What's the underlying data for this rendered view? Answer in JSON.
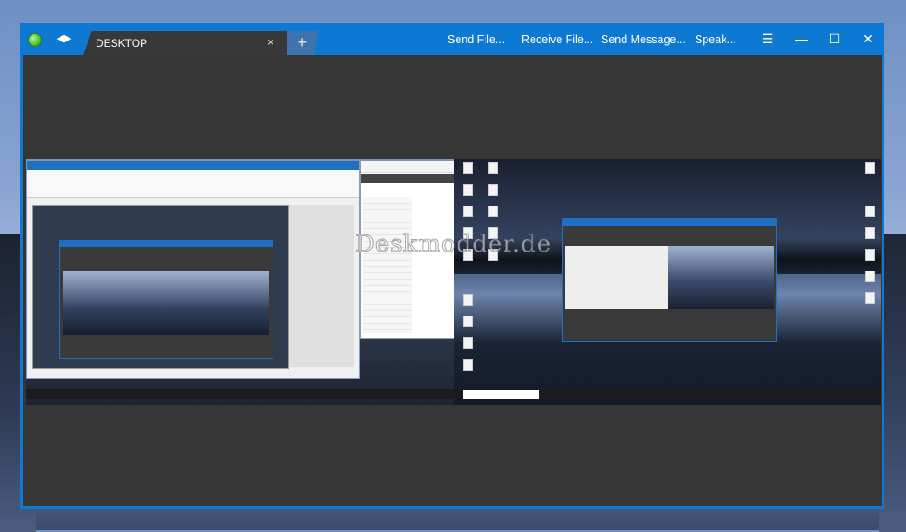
{
  "window": {
    "tab_title": "DESKTOP",
    "tab_close": "×",
    "new_tab": "+"
  },
  "menu": {
    "send_file": "Send File...",
    "receive_file": "Receive File...",
    "send_message": "Send Message...",
    "speak": "Speak..."
  },
  "controls": {
    "menu_icon": "☰",
    "minimize": "—",
    "maximize": "☐",
    "close": "✕",
    "swap_icon": "◀▶"
  },
  "watermark": "Deskmodder.de",
  "colors": {
    "title_bar": "#0e79d2",
    "tab_active": "#383838",
    "content_bg": "#363636",
    "status_dot": "#4fc42a"
  }
}
